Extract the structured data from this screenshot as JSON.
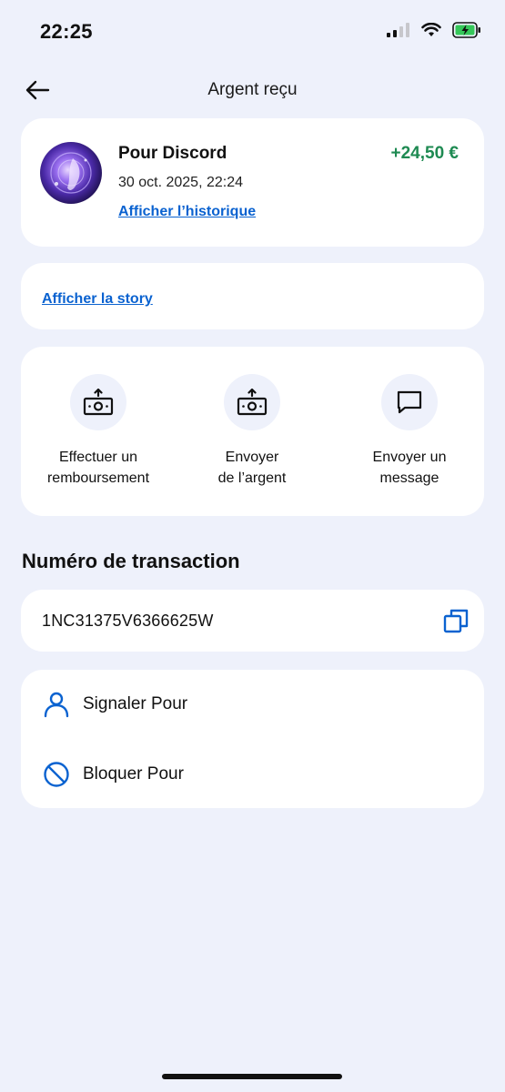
{
  "status_bar": {
    "time": "22:25",
    "icons": [
      "cellular-signal-icon",
      "wifi-icon",
      "battery-charging-icon"
    ]
  },
  "nav": {
    "back_icon": "arrow-left-icon",
    "title": "Argent reçu"
  },
  "summary": {
    "recipient": "Pour Discord",
    "date": "30 oct. 2025, 22:24",
    "history_link": "Afficher l’historique",
    "amount": "+24,50 €",
    "amount_color": "#1e8a52"
  },
  "story": {
    "link": "Afficher la story"
  },
  "actions": [
    {
      "icon": "money-send-icon",
      "label": "Effectuer un\nremboursement"
    },
    {
      "icon": "money-send-icon",
      "label": "Envoyer\nde l’argent"
    },
    {
      "icon": "message-bubble-icon",
      "label": "Envoyer un\nmessage"
    }
  ],
  "transaction": {
    "section_title": "Numéro de transaction",
    "number": "1NC31375V6366625W",
    "copy_icon": "copy-icon"
  },
  "options": [
    {
      "icon": "user-icon",
      "label": "Signaler Pour"
    },
    {
      "icon": "block-icon",
      "label": "Bloquer Pour"
    }
  ],
  "colors": {
    "background": "#eef1fb",
    "link": "#0a62d0",
    "accent_blue": "#0a62d0",
    "positive": "#1e8a52"
  }
}
